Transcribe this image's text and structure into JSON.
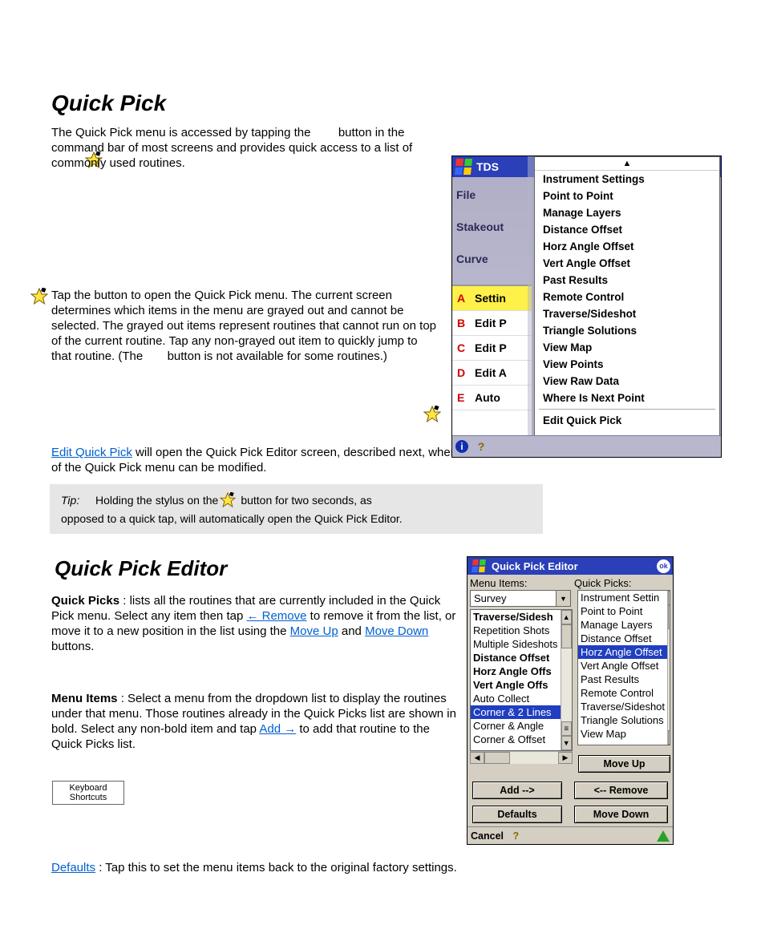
{
  "doc": {
    "line1": "Quick Pick",
    "p1a": "The Quick Pick menu is accessed by tapping the ",
    "p1b": " button in the command bar of most screens and provides quick access to a list of commonly used routines.",
    "p2a": "Tap the ",
    "p2b": " button to open the Quick Pick menu. The current screen determines which items in the menu are grayed out and cannot be selected. The grayed out items represent routines that cannot run on top of the current routine. Tap any non-grayed out item to quickly jump to that routine. (The ",
    "p2c": " button is not available for some routines.)",
    "editlink": "Edit Quick Pick",
    "p3": " will open the Quick Pick Editor screen, described next, where the contents of the Quick Pick menu can be modified.",
    "tip_label": "Tip:",
    "tip_text1": "Holding the stylus on the ",
    "tip_text2": " button for two seconds, as opposed to a quick tap, will automatically open the Quick Pick Editor.",
    "qpe_h": "Quick Pick Editor",
    "pick_a": "Quick Picks",
    "pick_b": ": lists all the routines that are currently included in the Quick Pick menu. Select any item then tap ",
    "remove_link": "← Remove",
    "pick_c": " to remove it from the list, or move it to a new position in the list using the ",
    "mu": "Move Up",
    "and": " and ",
    "md": "Move Down",
    "pick_d": " buttons.",
    "mi_a": "Menu Items",
    "mi_b": ": Select a menu from the dropdown list to display the routines under that menu. Those routines already in the Quick Picks list are shown in bold. Select any non-bold item and tap ",
    "add_link": "Add →",
    "mi_c": " to add that routine to the Quick Picks list.",
    "def_a": "Defaults",
    "def_b": ": Tap this to set the menu items back to the original factory settings.",
    "kbd": "Keyboard Shortcuts"
  },
  "shot1": {
    "title": "TDS",
    "menu": {
      "file": "File",
      "stake": "Stakeout",
      "curve": "Curve"
    },
    "rows": [
      {
        "l": "A",
        "t": "Settin",
        "sel": true
      },
      {
        "l": "B",
        "t": "Edit P",
        "sel": false
      },
      {
        "l": "C",
        "t": "Edit P",
        "sel": false
      },
      {
        "l": "D",
        "t": "Edit A",
        "sel": false
      },
      {
        "l": "E",
        "t": "Auto",
        "sel": false
      }
    ],
    "popup": [
      "Instrument Settings",
      "Point to Point",
      "Manage Layers",
      "Distance Offset",
      "Horz Angle Offset",
      "Vert Angle Offset",
      "Past Results",
      "Remote Control",
      "Traverse/Sideshot",
      "Triangle Solutions",
      "View Map",
      "View Points",
      "View Raw Data",
      "Where Is Next Point"
    ],
    "popup_last": "Edit Quick Pick"
  },
  "shot2": {
    "title": "Quick Pick Editor",
    "ok": "ok",
    "lab_mi": "Menu Items:",
    "lab_qp": "Quick Picks:",
    "dd_value": "Survey",
    "left": [
      {
        "t": "Traverse/Sidesh",
        "b": true,
        "s": false
      },
      {
        "t": "Repetition Shots",
        "b": false,
        "s": false
      },
      {
        "t": "Multiple Sideshots",
        "b": false,
        "s": false
      },
      {
        "t": "Distance Offset",
        "b": true,
        "s": false
      },
      {
        "t": "Horz Angle Offs",
        "b": true,
        "s": false
      },
      {
        "t": "Vert Angle Offs",
        "b": true,
        "s": false
      },
      {
        "t": "Auto Collect",
        "b": false,
        "s": false
      },
      {
        "t": "Corner & 2 Lines",
        "b": false,
        "s": true
      },
      {
        "t": "Corner & Angle",
        "b": false,
        "s": false
      },
      {
        "t": "Corner & Offset",
        "b": false,
        "s": false
      }
    ],
    "right": [
      {
        "t": "Instrument Settin",
        "s": false
      },
      {
        "t": "Point to Point",
        "s": false
      },
      {
        "t": "Manage Layers",
        "s": false
      },
      {
        "t": "Distance Offset",
        "s": false
      },
      {
        "t": "Horz Angle Offset",
        "s": true
      },
      {
        "t": "Vert Angle Offset",
        "s": false
      },
      {
        "t": "Past Results",
        "s": false
      },
      {
        "t": "Remote Control",
        "s": false
      },
      {
        "t": "Traverse/Sideshot",
        "s": false
      },
      {
        "t": "Triangle Solutions",
        "s": false
      },
      {
        "t": "View Map",
        "s": false
      }
    ],
    "btn_moveup": "Move Up",
    "btn_add": "Add -->",
    "btn_remove": "<-- Remove",
    "btn_defaults": "Defaults",
    "btn_movedown": "Move Down",
    "cancel": "Cancel"
  }
}
